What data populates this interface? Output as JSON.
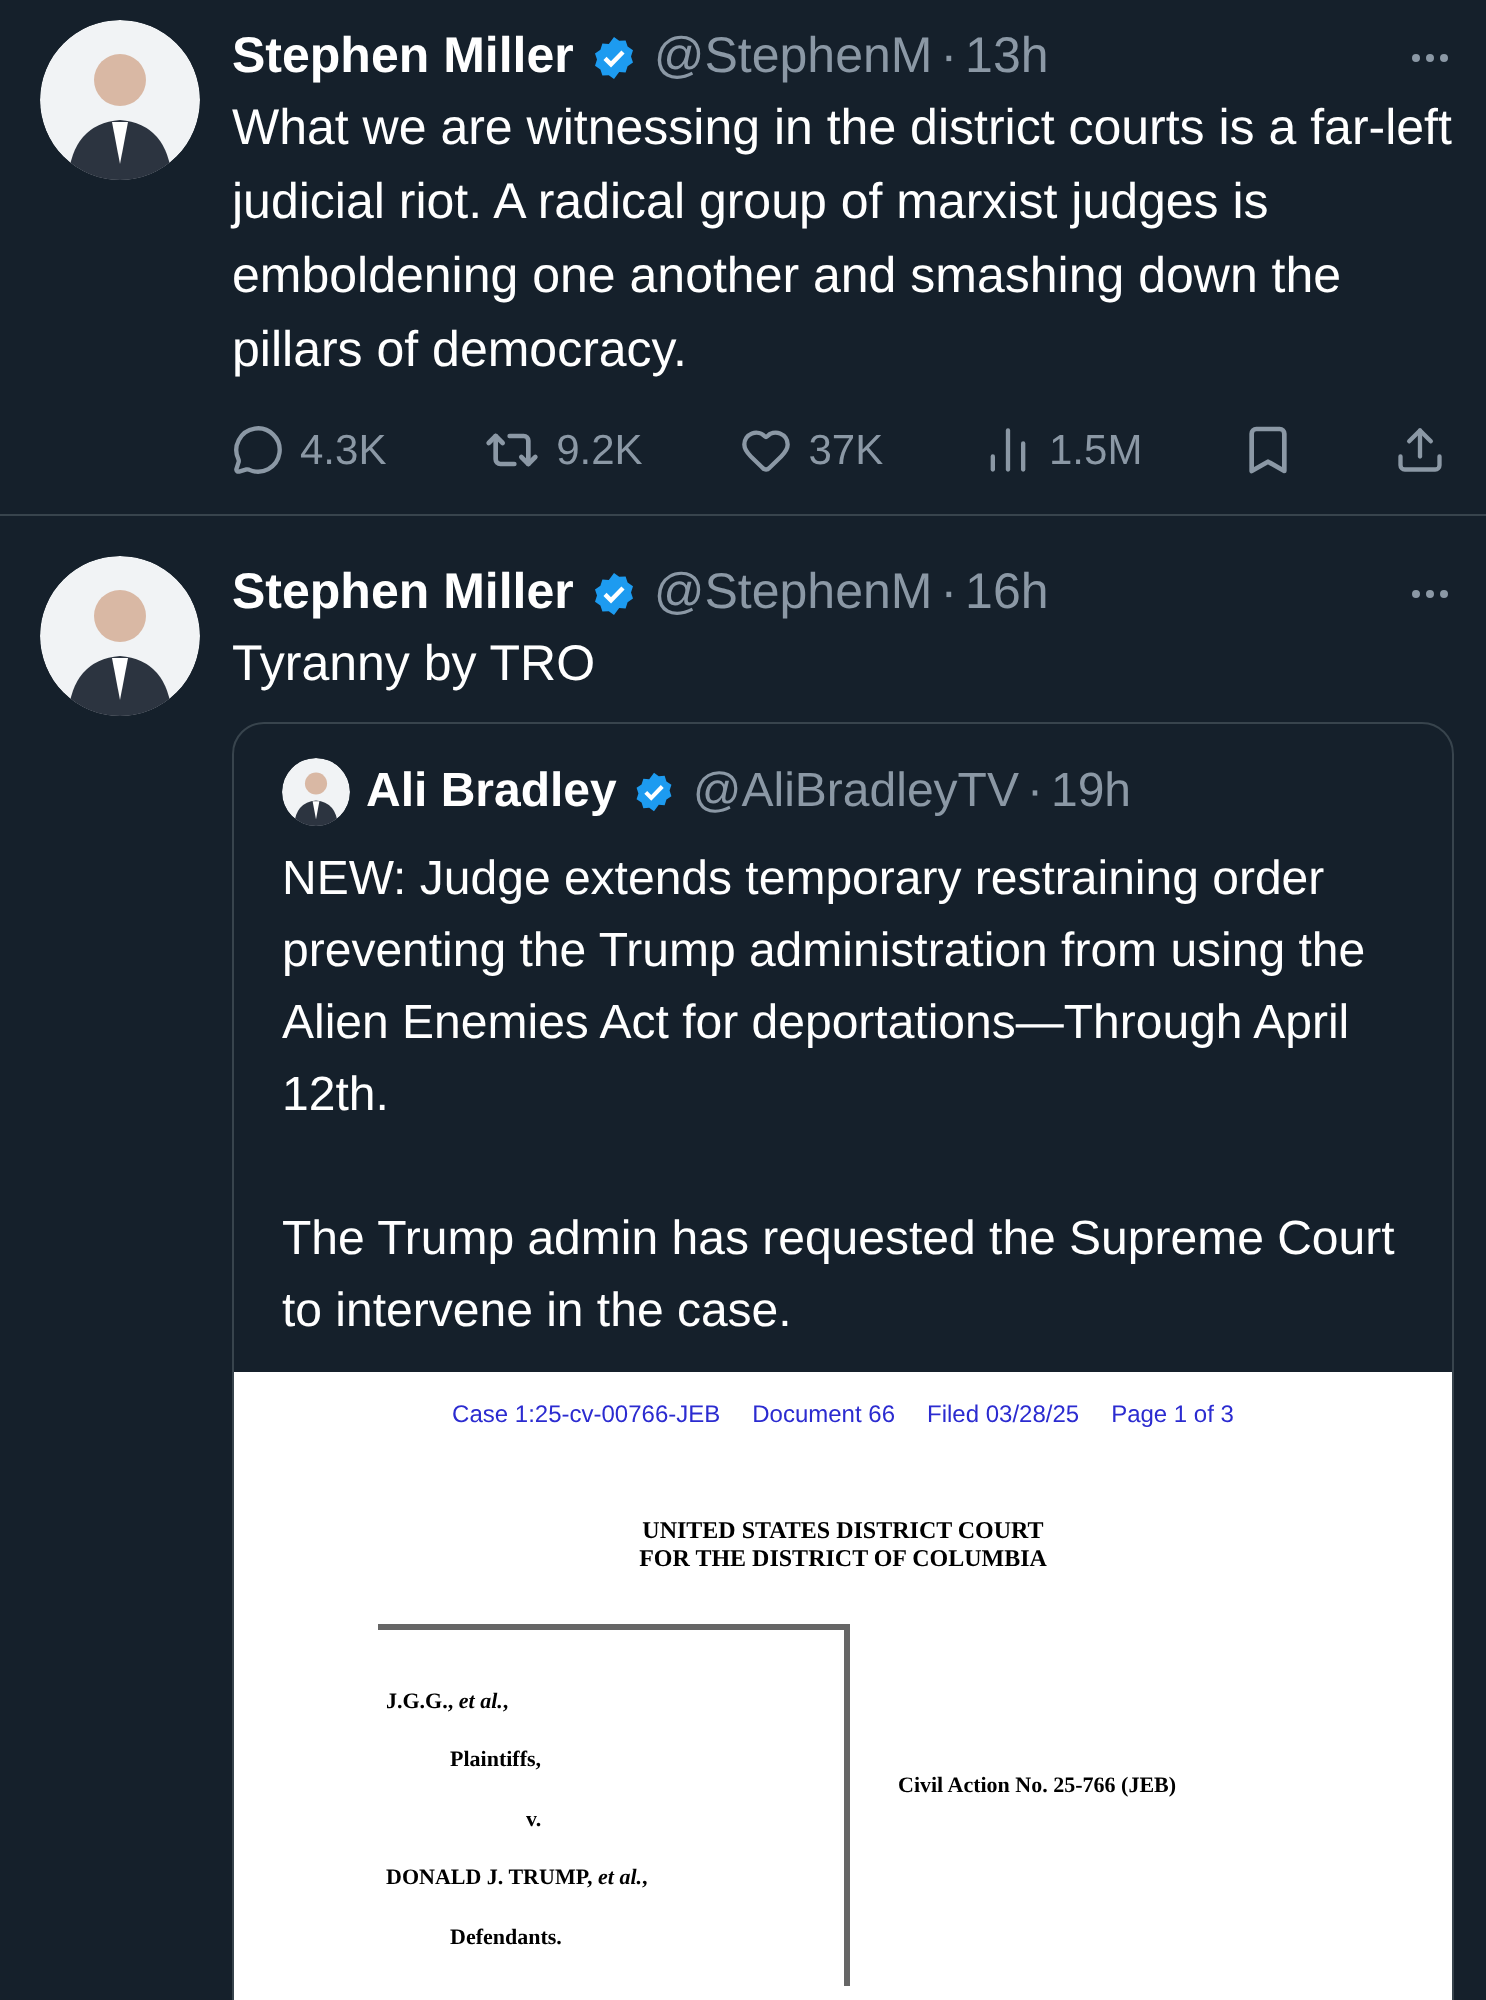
{
  "tweets": [
    {
      "author": "Stephen Miller",
      "verified": true,
      "handle": "@StephenM",
      "dot": "·",
      "time": "13h",
      "text": "What we are witnessing in the district courts is a far-left judicial riot. A radical group of marxist judges is emboldening one another and smashing down the pillars of democracy.",
      "stats": {
        "replies": "4.3K",
        "reposts": "9.2K",
        "likes": "37K",
        "views": "1.5M"
      }
    },
    {
      "author": "Stephen Miller",
      "verified": true,
      "handle": "@StephenM",
      "dot": "·",
      "time": "16h",
      "text": "Tyranny by TRO",
      "quote": {
        "author": "Ali Bradley",
        "verified": true,
        "handle": "@AliBradleyTV",
        "dot": "·",
        "time": "19h",
        "paragraphs": [
          "NEW: Judge extends temporary restraining order preventing the Trump administration from using the Alien Enemies Act for deportations—Through April 12th.",
          "The Trump admin has requested the Supreme Court to intervene in the case."
        ],
        "document": {
          "header": [
            "Case 1:25-cv-00766-JEB",
            "Document 66",
            "Filed 03/28/25",
            "Page 1 of 3"
          ],
          "court": [
            "UNITED STATES DISTRICT COURT",
            "FOR THE DISTRICT OF COLUMBIA"
          ],
          "caption": [
            {
              "kind": "party",
              "text": "J.G.G., *et al.*,"
            },
            {
              "kind": "role",
              "text": "Plaintiffs,"
            },
            {
              "kind": "versus",
              "text": "v."
            },
            {
              "kind": "party",
              "text": "DONALD J. TRUMP, *et al.*,"
            },
            {
              "kind": "role",
              "text": "Defendants."
            }
          ],
          "civil_action": "Civil Action No. 25-766 (JEB)"
        }
      }
    }
  ]
}
